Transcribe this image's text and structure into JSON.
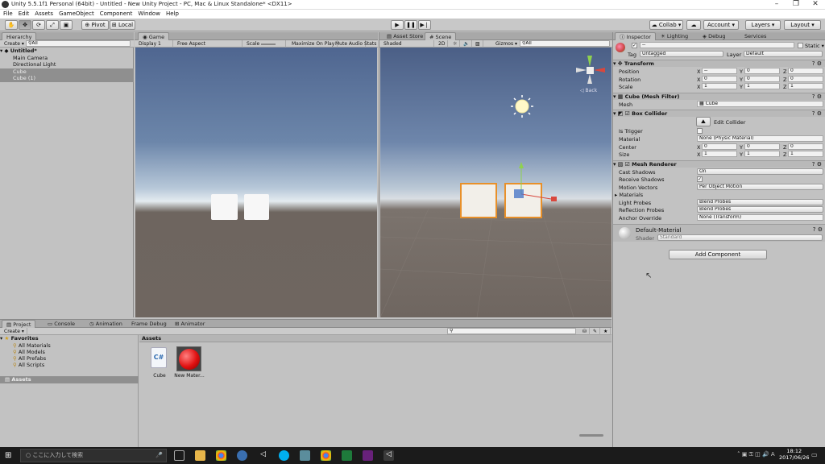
{
  "window": {
    "title": "Unity 5.5.1f1 Personal (64bit) - Untitled - New Unity Project - PC, Mac & Linux Standalone* <DX11>",
    "minimize": "–",
    "restore": "❐",
    "close": "✕"
  },
  "menu": [
    "File",
    "Edit",
    "Assets",
    "GameObject",
    "Component",
    "Window",
    "Help"
  ],
  "toolbar": {
    "pivot": "Pivot",
    "local": "Local",
    "collab": "Collab ▾",
    "account": "Account ▾",
    "layers": "Layers ▾",
    "layout": "Layout ▾"
  },
  "hierarchy": {
    "tab": "Hierarchy",
    "create": "Create ▾",
    "search": "All",
    "scene": "Untitled*",
    "items": [
      "Main Camera",
      "Directional Light",
      "Cube",
      "Cube (1)"
    ]
  },
  "game": {
    "tab": "Game",
    "display": "Display 1",
    "aspect": "Free Aspect",
    "scale_label": "Scale",
    "scale_value": "1x",
    "maximize": "Maximize On Play",
    "mute": "Mute Audio",
    "stats": "Stats"
  },
  "scene": {
    "tab_store": "Asset Store",
    "tab": "Scene",
    "shading": "Shaded",
    "mode2d": "2D",
    "gizmos": "Gizmos ▾",
    "search": "All",
    "back": "◁ Back"
  },
  "inspector": {
    "tabs": [
      "Inspector",
      "Lighting",
      "Debug",
      "Services"
    ],
    "name": "--",
    "static": "Static ▾",
    "tag_label": "Tag",
    "tag": "Untagged",
    "layer_label": "Layer",
    "layer": "Default",
    "transform": {
      "title": "Transform",
      "rows": [
        {
          "label": "Position",
          "x": "--",
          "y": "0",
          "z": "0"
        },
        {
          "label": "Rotation",
          "x": "0",
          "y": "0",
          "z": "0"
        },
        {
          "label": "Scale",
          "x": "1",
          "y": "1",
          "z": "1"
        }
      ]
    },
    "mesh_filter": {
      "title": "Cube (Mesh Filter)",
      "label": "Mesh",
      "value": "Cube"
    },
    "box_collider": {
      "title": "Box Collider",
      "edit": "Edit Collider",
      "is_trigger": "Is Trigger",
      "material_label": "Material",
      "material": "None (Physic Material)",
      "center_label": "Center",
      "center": {
        "x": "0",
        "y": "0",
        "z": "0"
      },
      "size_label": "Size",
      "size": {
        "x": "1",
        "y": "1",
        "z": "1"
      }
    },
    "mesh_renderer": {
      "title": "Mesh Renderer",
      "rows": [
        {
          "label": "Cast Shadows",
          "value": "On"
        },
        {
          "label": "Receive Shadows",
          "value": "✓"
        },
        {
          "label": "Motion Vectors",
          "value": "Per Object Motion"
        },
        {
          "label": "Materials",
          "value": ""
        },
        {
          "label": "Light Probes",
          "value": "Blend Probes"
        },
        {
          "label": "Reflection Probes",
          "value": "Blend Probes"
        },
        {
          "label": "Anchor Override",
          "value": "None (Transform)"
        }
      ]
    },
    "material": {
      "name": "Default-Material",
      "shader_label": "Shader",
      "shader": "Standard"
    },
    "add_component": "Add Component"
  },
  "project": {
    "tabs": [
      "Project",
      "Console",
      "Animation",
      "Frame Debug",
      "Animator"
    ],
    "create": "Create ▾",
    "favorites": "Favorites",
    "fav_items": [
      "All Materials",
      "All Models",
      "All Prefabs",
      "All Scripts"
    ],
    "assets_folder": "Assets",
    "assets_title": "Assets",
    "files": [
      {
        "name": "Cube",
        "type": "script",
        "glyph": "C#"
      },
      {
        "name": "New Mater...",
        "type": "material"
      }
    ]
  },
  "taskbar": {
    "search": "ここに入力して検索",
    "time": "18:12",
    "date": "2017/06/26"
  },
  "colors": {
    "sky_top": "#5a6f95",
    "ground": "#6f6660",
    "select_orange": "#e8902a"
  }
}
